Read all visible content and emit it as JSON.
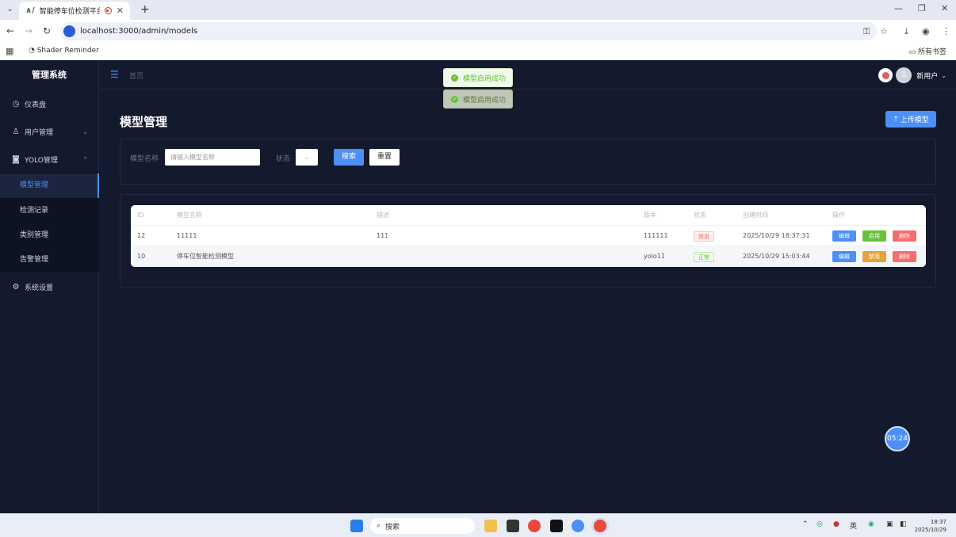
{
  "browser": {
    "tab_title": "智能停车位检测平台",
    "url": "localhost:3000/admin/models",
    "bookmark": "Shader Reminder",
    "all_bookmarks": "所有书签"
  },
  "sidebar": {
    "brand": "管理系统",
    "items": [
      {
        "label": "仪表盘",
        "icon": "dashboard-icon"
      },
      {
        "label": "用户管理",
        "icon": "user-icon"
      },
      {
        "label": "YOLO管理",
        "icon": "camera-icon"
      },
      {
        "label": "系统设置",
        "icon": "gear-icon"
      }
    ],
    "sub_items": [
      {
        "label": "模型管理"
      },
      {
        "label": "检测记录"
      },
      {
        "label": "类别管理"
      },
      {
        "label": "告警管理"
      }
    ]
  },
  "topbar": {
    "breadcrumb": "首页",
    "user_name": "新用户"
  },
  "toasts": [
    "模型启用成功",
    "模型启用成功"
  ],
  "page": {
    "title": "模型管理",
    "upload_button": "上传模型"
  },
  "search": {
    "name_label": "模型名称",
    "name_placeholder": "请输入模型名称",
    "status_label": "状态",
    "search_button": "搜索",
    "reset_button": "重置"
  },
  "table": {
    "headers": [
      "ID",
      "模型名称",
      "描述",
      "版本",
      "状态",
      "创建时间",
      "操作"
    ],
    "rows": [
      {
        "id": "12",
        "name": "11111",
        "desc": "111",
        "version": "111111",
        "status": "禁用",
        "created": "2025/10/29 18:37:31",
        "actions": [
          "编辑",
          "启用",
          "删除"
        ]
      },
      {
        "id": "10",
        "name": "停车位智能检测模型",
        "desc": "",
        "version": "yolo11",
        "status": "正常",
        "created": "2025/10/29 15:03:44",
        "actions": [
          "编辑",
          "禁用",
          "删除"
        ]
      }
    ]
  },
  "timer": "05:24",
  "taskbar": {
    "search_placeholder": "搜索",
    "ime": "英",
    "time": "18:37",
    "date": "2025/10/29"
  }
}
